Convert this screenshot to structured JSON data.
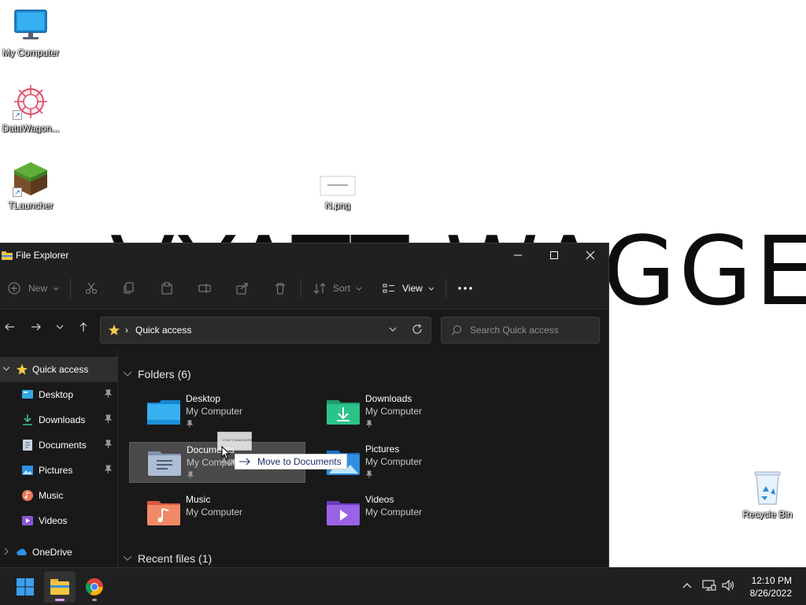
{
  "desktop": {
    "wallpaper_text": "VYATT WAGGERS",
    "icons": [
      {
        "label": "My Computer",
        "icon": "monitor-icon"
      },
      {
        "label": "DataWagon...",
        "icon": "datawagon-icon"
      },
      {
        "label": "TLauncher",
        "icon": "minecraft-block-icon"
      },
      {
        "label": "N.png",
        "icon": "image-file-icon"
      },
      {
        "label": "Recycle Bin",
        "icon": "recycle-bin-icon"
      }
    ]
  },
  "window": {
    "title": "File Explorer",
    "toolbar": {
      "new_label": "New",
      "sort_label": "Sort",
      "view_label": "View"
    },
    "address": {
      "location": "Quick access"
    },
    "search": {
      "placeholder": "Search Quick access"
    },
    "nav": [
      {
        "label": "Quick access",
        "icon": "star-icon",
        "level": "root",
        "expanded": true
      },
      {
        "label": "Desktop",
        "icon": "desktop-folder-icon",
        "pinned": true
      },
      {
        "label": "Downloads",
        "icon": "download-icon",
        "pinned": true
      },
      {
        "label": "Documents",
        "icon": "document-icon",
        "pinned": true
      },
      {
        "label": "Pictures",
        "icon": "pictures-icon",
        "pinned": true
      },
      {
        "label": "Music",
        "icon": "music-icon",
        "pinned": false
      },
      {
        "label": "Videos",
        "icon": "video-icon",
        "pinned": false
      },
      {
        "label": "OneDrive",
        "icon": "cloud-icon",
        "level": "root",
        "expanded": false
      }
    ],
    "groups": {
      "folders_header": "Folders (6)",
      "recent_header": "Recent files (1)"
    },
    "folders": [
      {
        "name": "Desktop",
        "location": "My Computer",
        "pinned": true
      },
      {
        "name": "Downloads",
        "location": "My Computer",
        "pinned": true
      },
      {
        "name": "Documents",
        "location": "My Computer",
        "pinned": true
      },
      {
        "name": "Pictures",
        "location": "My Computer",
        "pinned": true
      },
      {
        "name": "Music",
        "location": "My Computer",
        "pinned": false
      },
      {
        "name": "Videos",
        "location": "My Computer",
        "pinned": false
      }
    ]
  },
  "drag": {
    "tooltip": "Move to Documents",
    "file_label": "4.pn",
    "thumb_text": "VYATT WAGGERS"
  },
  "taskbar": {
    "time": "12:10 PM",
    "date": "8/26/2022"
  },
  "colors": {
    "accent": "#0078d4",
    "window_bg": "#191919",
    "titlebar_bg": "#202020",
    "taskbar_bg": "#202020",
    "folder_yellow": "#f2c94c"
  }
}
